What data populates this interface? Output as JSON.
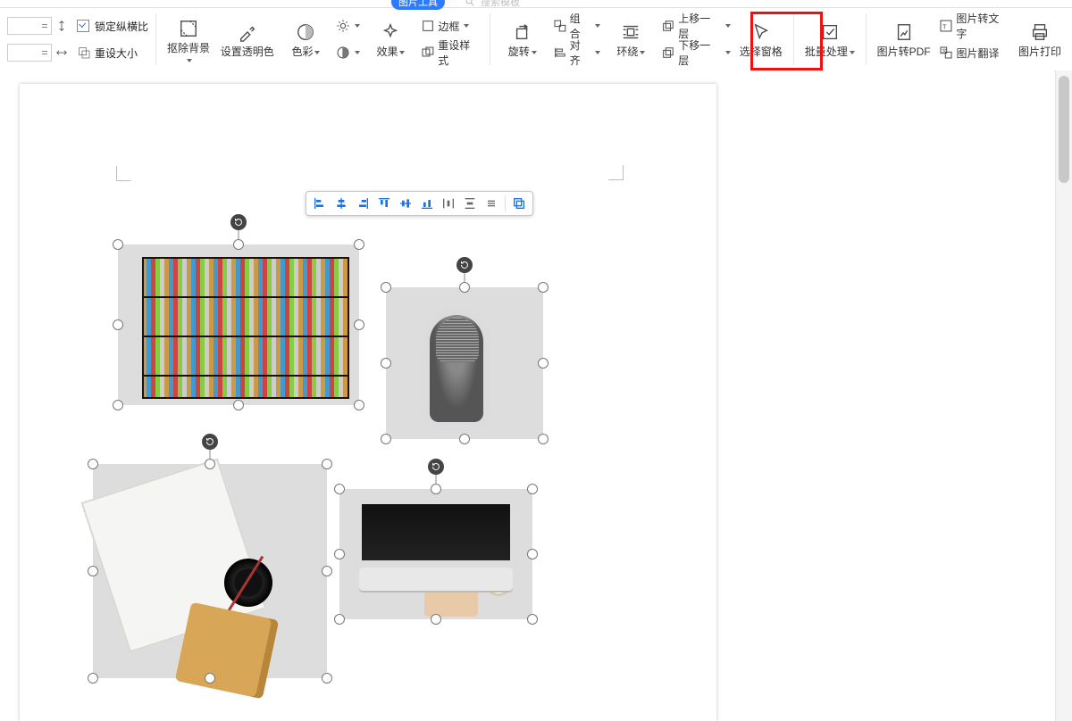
{
  "tabs": {
    "active_pill": "图片工具"
  },
  "search_placeholder": "搜索模板",
  "size_group": {
    "lock_ratio": "锁定纵横比",
    "reset_size": "重设大小"
  },
  "ribbon": {
    "remove_bg": "抠除背景",
    "set_transparent": "设置透明色",
    "color": "色彩",
    "effect": "效果",
    "border": "边框",
    "reset_style": "重设样式",
    "rotate": "旋转",
    "group": "组合",
    "align": "对齐",
    "wrap": "环绕",
    "move_up": "上移一层",
    "move_down": "下移一层",
    "select_pane": "选择窗格",
    "batch": "批量处理",
    "to_pdf": "图片转PDF",
    "to_text": "图片转文字",
    "translate": "图片翻译",
    "print": "图片打印"
  },
  "float_toolbar": {
    "items": [
      "align-left",
      "align-center-h",
      "align-right",
      "align-top",
      "align-middle-v",
      "align-bottom",
      "distribute-h",
      "distribute-v",
      "equal-size",
      "crop-same"
    ]
  }
}
